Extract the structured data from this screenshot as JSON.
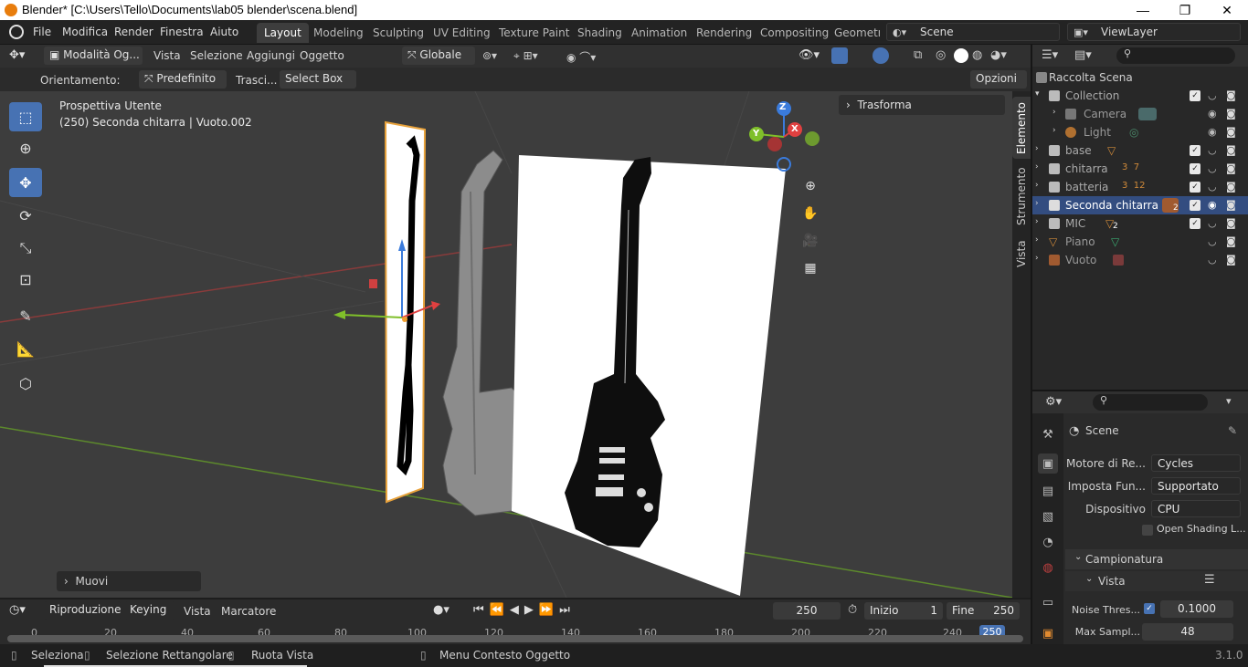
{
  "window": {
    "title": "Blender* [C:\\Users\\Tello\\Documents\\lab05 blender\\scena.blend]",
    "min": "—",
    "max": "❐",
    "close": "✕"
  },
  "menu": {
    "items": [
      "File",
      "Modifica",
      "Render",
      "Finestra",
      "Aiuto"
    ],
    "workspaces": [
      "Layout",
      "Modeling",
      "Sculpting",
      "UV Editing",
      "Texture Paint",
      "Shading",
      "Animation",
      "Rendering",
      "Compositing",
      "Geometry"
    ],
    "scene": "Scene",
    "view_layer": "ViewLayer"
  },
  "viewport_header": {
    "mode": "Modalità Og...",
    "menus": [
      "Vista",
      "Selezione",
      "Aggiungi",
      "Oggetto"
    ],
    "transform_orientation": "Globale"
  },
  "tool_header": {
    "orient_label": "Orientamento:",
    "orient_value": "Predefinito",
    "drag_label": "Trasci...",
    "drag_value": "Select Box",
    "options": "Opzioni"
  },
  "viewport": {
    "view_name": "Prospettiva Utente",
    "object_info": "(250) Seconda chitarra | Vuoto.002",
    "transform_panel": "Trasforma",
    "last_op": "Muovi",
    "gizmo": {
      "x": "X",
      "y": "Y",
      "z": "Z"
    }
  },
  "n_panel_tabs": [
    "Elemento",
    "Strumento",
    "Vista"
  ],
  "timeline": {
    "menus": [
      "Riproduzione",
      "Keying",
      "Vista",
      "Marcatore"
    ],
    "current_frame": "250",
    "start_label": "Inizio",
    "start": "1",
    "end_label": "Fine",
    "end": "250",
    "ticks": [
      "0",
      "20",
      "40",
      "60",
      "80",
      "100",
      "120",
      "140",
      "160",
      "180",
      "200",
      "220",
      "240"
    ],
    "marker": "250"
  },
  "status": {
    "select": "Seleziona",
    "box_select": "Selezione Rettangolare",
    "rotate": "Ruota Vista",
    "context": "Menu Contesto Oggetto",
    "version": "3.1.0"
  },
  "outliner": {
    "root": "Raccolta Scena",
    "rows": [
      {
        "name": "Collection",
        "badge": ""
      },
      {
        "name": "Camera",
        "badge": ""
      },
      {
        "name": "Light",
        "badge": ""
      },
      {
        "name": "base",
        "badge": ""
      },
      {
        "name": "chitarra",
        "badge": "3  7"
      },
      {
        "name": "batteria",
        "badge": "3  12"
      },
      {
        "name": "Seconda chitarra",
        "badge": "2"
      },
      {
        "name": "MIC",
        "badge": "2"
      },
      {
        "name": "Piano",
        "badge": ""
      },
      {
        "name": "Vuoto",
        "badge": ""
      }
    ]
  },
  "properties": {
    "context": "Scene",
    "render_engine_label": "Motore di Re...",
    "render_engine": "Cycles",
    "feature_set_label": "Imposta Fun...",
    "feature_set": "Supportato",
    "device_label": "Dispositivo",
    "device": "CPU",
    "osl_label": "Open Shading L...",
    "sampling": "Campionatura",
    "viewport": "Vista",
    "noise_label": "Noise Thres...",
    "noise_value": "0.1000",
    "max_samples_label": "Max Sampl...",
    "max_samples": "48"
  }
}
